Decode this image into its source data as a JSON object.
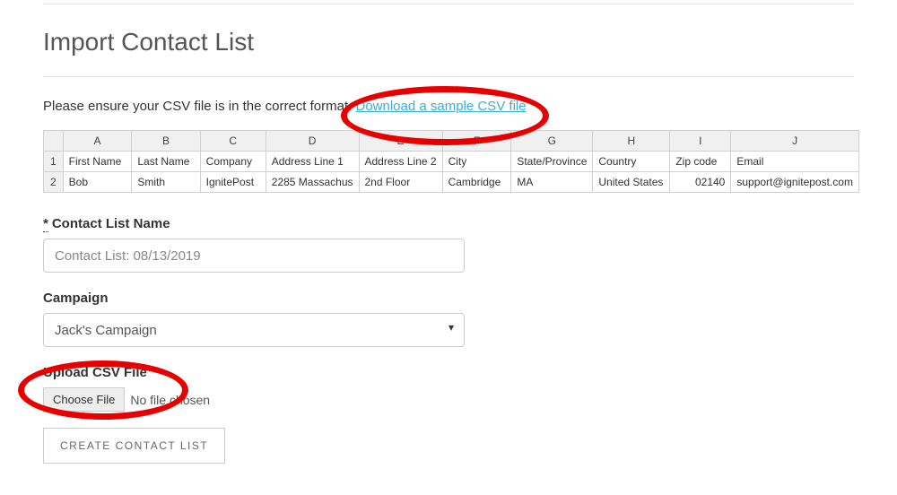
{
  "page_title": "Import Contact List",
  "instruction_prefix": "Please ensure your CSV file is in the correct format. ",
  "download_link_text": "Download a sample CSV file",
  "spreadsheet": {
    "columns": [
      "A",
      "B",
      "C",
      "D",
      "E",
      "F",
      "G",
      "H",
      "I",
      "J"
    ],
    "rows": [
      {
        "num": "1",
        "cells": [
          "First Name",
          "Last Name",
          "Company",
          "Address Line 1",
          "Address Line 2",
          "City",
          "State/Province",
          "Country",
          "Zip code",
          "Email"
        ]
      },
      {
        "num": "2",
        "cells": [
          "Bob",
          "Smith",
          "IgnitePost",
          "2285 Massachus",
          "2nd Floor",
          "Cambridge",
          "MA",
          "United States",
          "02140",
          "support@ignitepost.com"
        ]
      }
    ]
  },
  "form": {
    "contact_list_label": "Contact List Name",
    "contact_list_value": "Contact List: 08/13/2019",
    "campaign_label": "Campaign",
    "campaign_value": "Jack's Campaign",
    "upload_label": "Upload CSV File",
    "choose_file_btn": "Choose File",
    "file_status": "No file chosen",
    "create_btn": "CREATE CONTACT LIST",
    "required_mark": "*"
  }
}
